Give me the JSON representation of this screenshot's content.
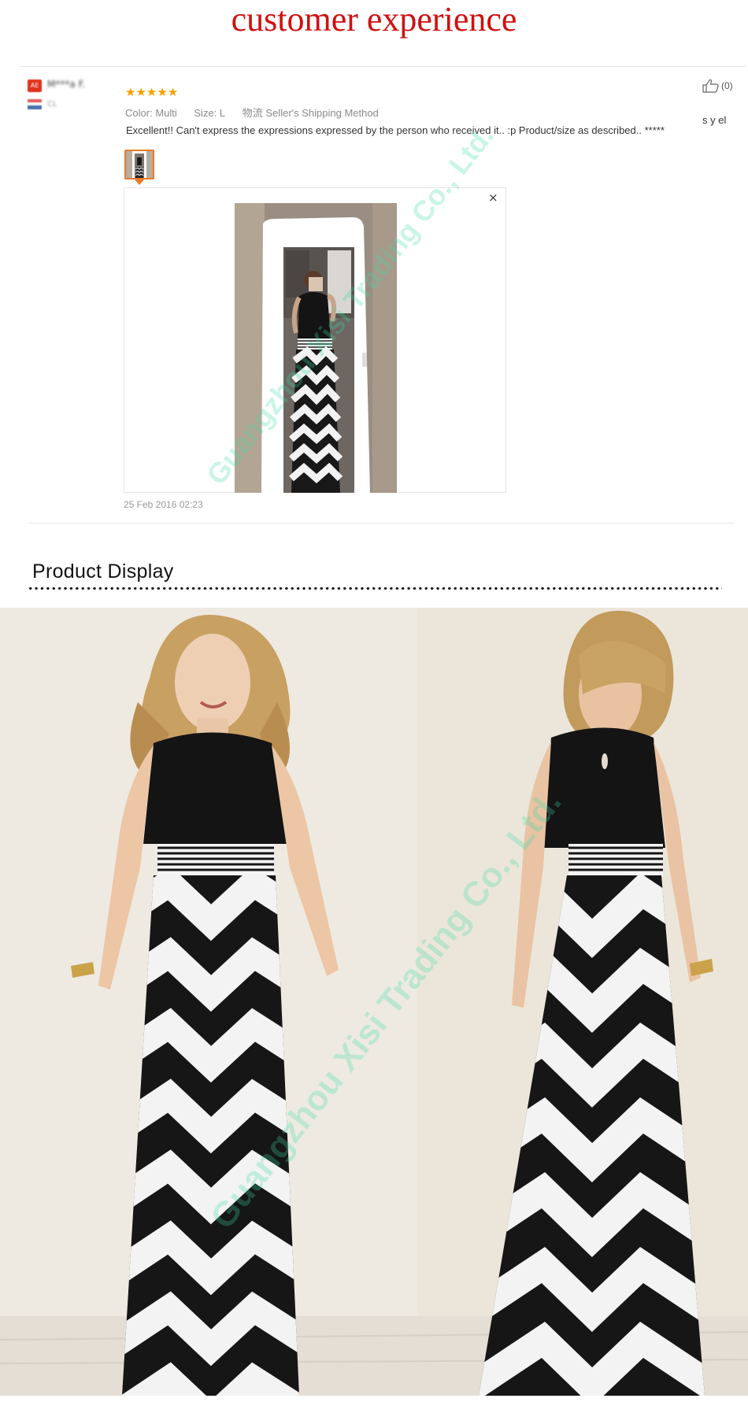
{
  "banner": {
    "title": "customer experience"
  },
  "review": {
    "reviewer_badge": "AE",
    "reviewer_name": "M***a F.",
    "country_code": "CL",
    "rating": 5,
    "stars_text": "★★★★★",
    "color_label": "Color:",
    "color_value": "Multi",
    "size_label": "Size:",
    "size_value": "L",
    "shipping_label": "物流",
    "shipping_value": "Seller's Shipping Method",
    "feedback_text": "Excellent!! Can't express the expressions expressed by the person who received it.. :p Product/size as described.. *****",
    "side_text": "s y el",
    "helpful_count": "(0)",
    "close_glyph": "×",
    "date": "25 Feb 2016 02:23"
  },
  "product_display": {
    "title": "Product Display"
  },
  "watermark": {
    "text": "Guangzhou Xisi Trading Co., Ltd."
  },
  "colors": {
    "banner_red": "#d01010",
    "star_orange": "#f5a000",
    "thumb_border": "#e87a2a",
    "watermark": "#3cdcaa"
  },
  "icons": {
    "helpful": "thumbs-up-icon",
    "close": "close-icon"
  }
}
